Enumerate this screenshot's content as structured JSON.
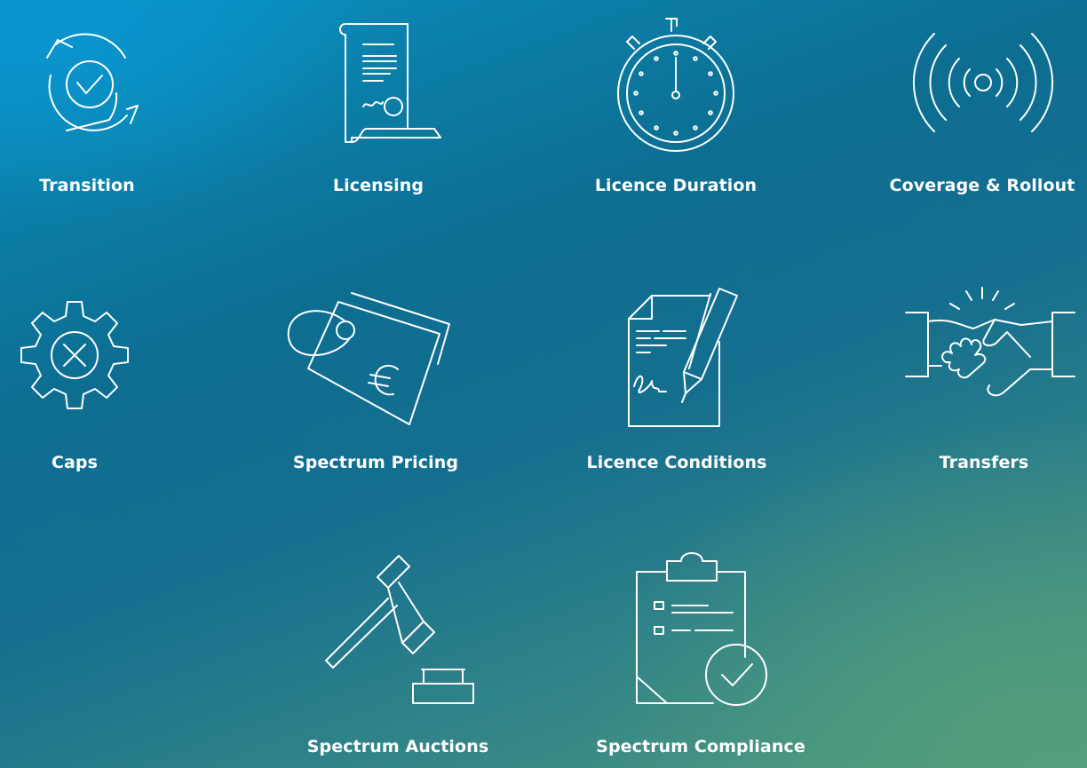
{
  "tiles": [
    {
      "label": "Transition",
      "icon": "circular-arrows-check-icon"
    },
    {
      "label": "Licensing",
      "icon": "scroll-document-icon"
    },
    {
      "label": "Licence Duration",
      "icon": "stopwatch-icon"
    },
    {
      "label": "Coverage & Rollout",
      "icon": "signal-broadcast-icon"
    },
    {
      "label": "Caps",
      "icon": "gear-x-icon"
    },
    {
      "label": "Spectrum Pricing",
      "icon": "euro-price-tag-icon"
    },
    {
      "label": "Licence Conditions",
      "icon": "document-pen-signature-icon"
    },
    {
      "label": "Transfers",
      "icon": "handshake-icon"
    },
    {
      "label": "Spectrum Auctions",
      "icon": "gavel-icon"
    },
    {
      "label": "Spectrum Compliance",
      "icon": "clipboard-check-icon"
    }
  ]
}
